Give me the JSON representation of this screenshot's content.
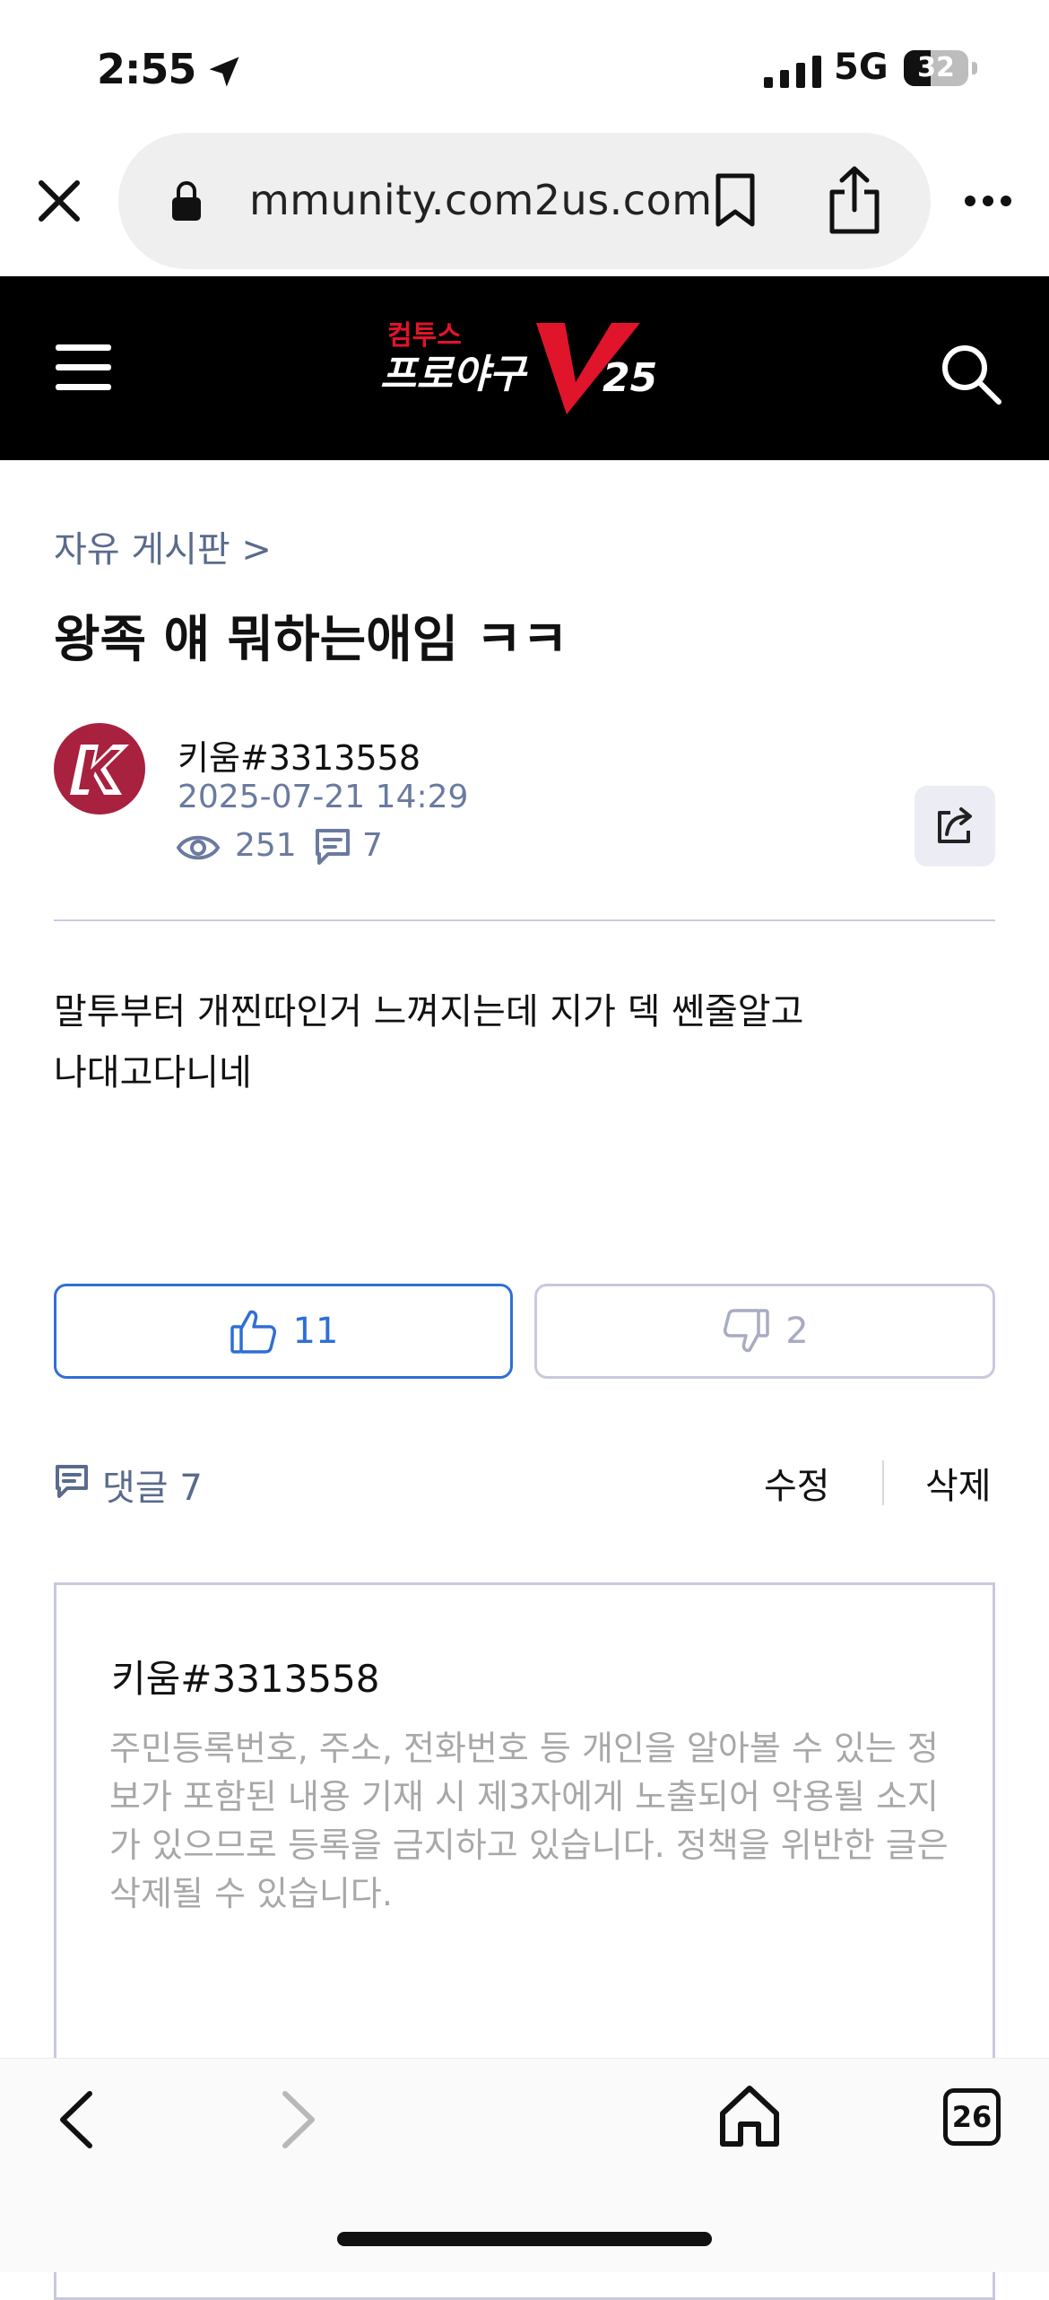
{
  "status_bar": {
    "time": "2:55",
    "network": "5G",
    "battery_level": "32"
  },
  "browser": {
    "url": "mmunity.com2us.com",
    "tab_count": "26"
  },
  "site": {
    "logo_brand": "컴투스",
    "logo_title": "프로야구",
    "logo_version": "V",
    "logo_year": "25"
  },
  "post": {
    "breadcrumb": "자유 게시판 >",
    "title": "왕족 얘 뭐하는애임 ㅋㅋ",
    "author": "키움#3313558",
    "date": "2025-07-21 14:29",
    "views": "251",
    "comment_count": "7",
    "body_lines": [
      "말투부터 개찐따인거 느껴지는데 지가 덱 쎈줄알고",
      "나대고다니네"
    ],
    "likes": "11",
    "dislikes": "2"
  },
  "comments": {
    "label": "댓글 7",
    "edit_label": "수정",
    "delete_label": "삭제",
    "commenter": "키움#3313558",
    "placeholder": "주민등록번호, 주소, 전화번호 등 개인을 알아볼 수 있는 정보가 포함된 내용 기재 시 제3자에게 노출되어 악용될 소지가 있으므로 등록을 금지하고 있습니다. 정책을 위반한 글은 삭제될 수 있습니다."
  },
  "colors": {
    "accent": "#2f6fd6",
    "muted": "#5a6b8c",
    "header_bg": "#000000",
    "logo_red": "#e0142a",
    "team_red": "#a8213f"
  },
  "icons": [
    "location-arrow-icon",
    "signal-icon",
    "battery-icon",
    "close-icon",
    "lock-icon",
    "bookmark-icon",
    "share-icon",
    "more-icon",
    "hamburger-icon",
    "search-icon",
    "eye-icon",
    "comment-icon",
    "share-post-icon",
    "thumbs-up-icon",
    "thumbs-down-icon",
    "back-icon",
    "forward-icon",
    "home-icon"
  ]
}
